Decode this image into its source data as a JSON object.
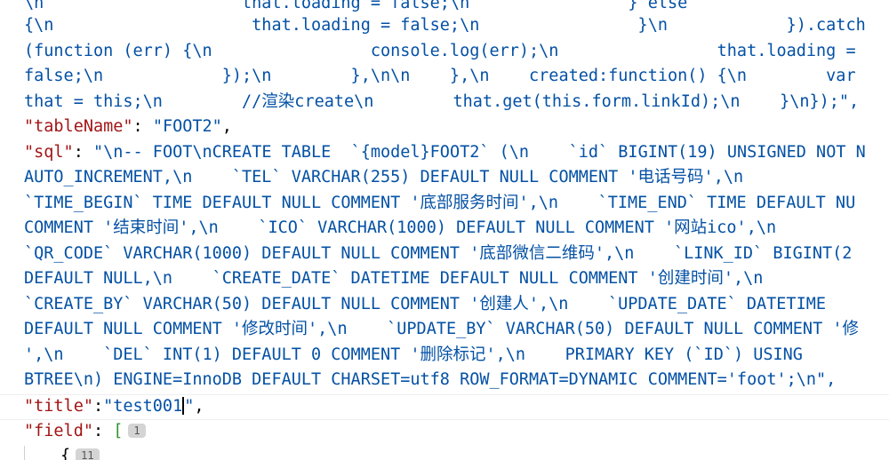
{
  "code": {
    "lines": [
      "\\n                    that.loading = false;\\n                } else",
      "{\\n                    that.loading = false;\\n                }\\n            }).catch",
      "(function (err) {\\n                console.log(err);\\n                that.loading =",
      "false;\\n            });\\n        },\\n\\n    },\\n    created:function() {\\n        var",
      "that = this;\\n        //渲染create\\n        that.get(this.form.linkId);\\n    }\\n});\","
    ],
    "table_name_key": "\"tableName\"",
    "table_name_value": "\"FOOT2\"",
    "sql_key": "\"sql\"",
    "sql_lines": [
      "\"\\n-- FOOT\\nCREATE TABLE  `{model}FOOT2` (\\n    `id` BIGINT(19) UNSIGNED NOT N",
      "AUTO_INCREMENT,\\n    `TEL` VARCHAR(255) DEFAULT NULL COMMENT '电话号码',\\n",
      "`TIME_BEGIN` TIME DEFAULT NULL COMMENT '底部服务时间',\\n    `TIME_END` TIME DEFAULT NU",
      "COMMENT '结束时间',\\n    `ICO` VARCHAR(1000) DEFAULT NULL COMMENT '网站ico',\\n",
      "`QR_CODE` VARCHAR(1000) DEFAULT NULL COMMENT '底部微信二维码',\\n    `LINK_ID` BIGINT(2",
      "DEFAULT NULL,\\n    `CREATE_DATE` DATETIME DEFAULT NULL COMMENT '创建时间',\\n",
      "`CREATE_BY` VARCHAR(50) DEFAULT NULL COMMENT '创建人',\\n    `UPDATE_DATE` DATETIME",
      "DEFAULT NULL COMMENT '修改时间',\\n    `UPDATE_BY` VARCHAR(50) DEFAULT NULL COMMENT '修",
      "',\\n    `DEL` INT(1) DEFAULT 0 COMMENT '删除标记',\\n    PRIMARY KEY (`ID`) USING",
      "BTREE\\n) ENGINE=InnoDB DEFAULT CHARSET=utf8 ROW_FORMAT=DYNAMIC COMMENT='foot';\\n\","
    ],
    "title_key": "\"title\"",
    "title_value_a": "\"test001",
    "title_value_b": "\"",
    "field_key": "\"field\"",
    "field_open": "[",
    "field_badge": "1",
    "object_open": "{",
    "object_badge": "11"
  }
}
